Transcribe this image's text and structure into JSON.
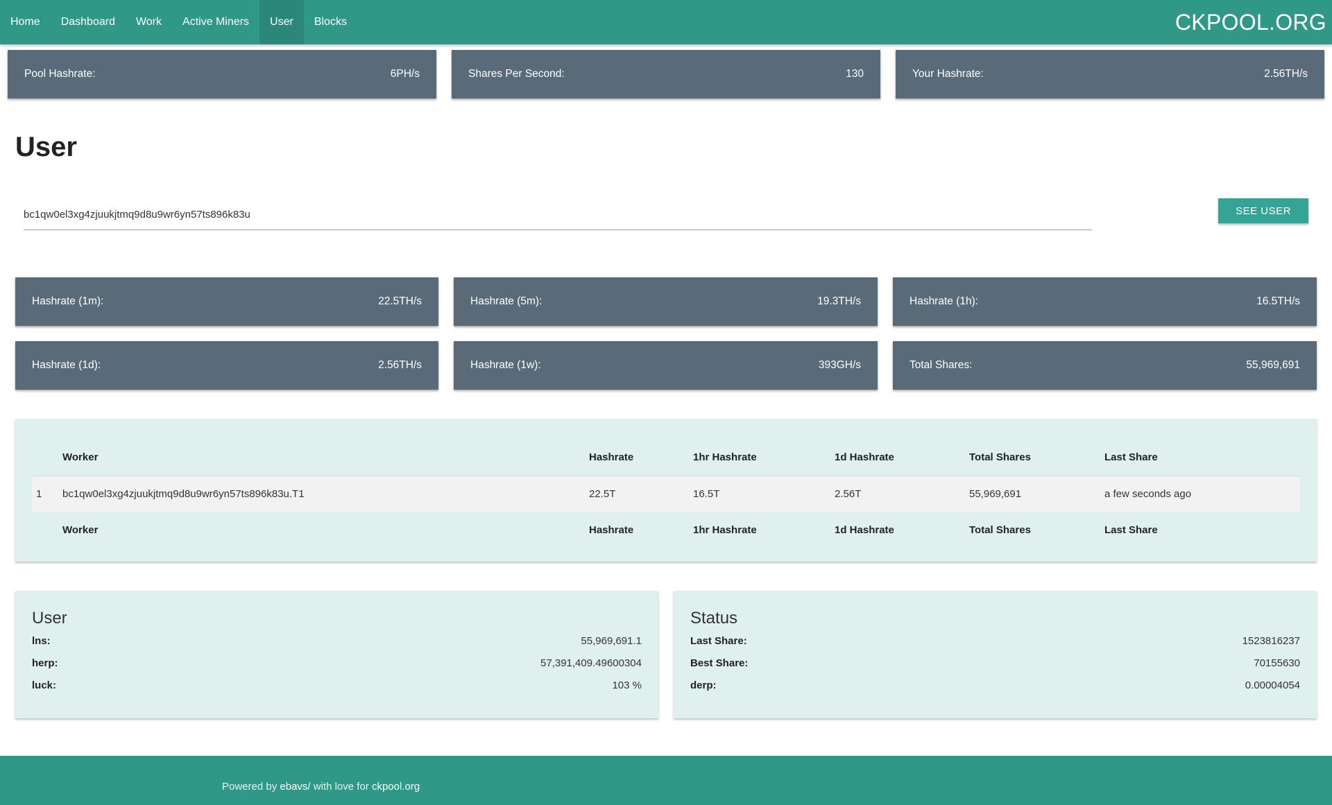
{
  "nav": {
    "items": [
      {
        "label": "Home",
        "active": false
      },
      {
        "label": "Dashboard",
        "active": false
      },
      {
        "label": "Work",
        "active": false
      },
      {
        "label": "Active Miners",
        "active": false
      },
      {
        "label": "User",
        "active": true
      },
      {
        "label": "Blocks",
        "active": false
      }
    ],
    "brand": "CKPOOL.ORG"
  },
  "pool_stats": [
    {
      "label": "Pool Hashrate:",
      "value": "6PH/s"
    },
    {
      "label": "Shares Per Second:",
      "value": "130"
    },
    {
      "label": "Your Hashrate:",
      "value": "2.56TH/s"
    }
  ],
  "page_title": "User",
  "search": {
    "value": "bc1qw0el3xg4zjuukjtmq9d8u9wr6yn57ts896k83u",
    "button_label": "SEE USER"
  },
  "user_stats": [
    {
      "label": "Hashrate (1m):",
      "value": "22.5TH/s"
    },
    {
      "label": "Hashrate (5m):",
      "value": "19.3TH/s"
    },
    {
      "label": "Hashrate (1h):",
      "value": "16.5TH/s"
    },
    {
      "label": "Hashrate (1d):",
      "value": "2.56TH/s"
    },
    {
      "label": "Hashrate (1w):",
      "value": "393GH/s"
    },
    {
      "label": "Total Shares:",
      "value": "55,969,691"
    }
  ],
  "workers_table": {
    "columns": [
      "Worker",
      "Hashrate",
      "1hr Hashrate",
      "1d Hashrate",
      "Total Shares",
      "Last Share"
    ],
    "rows": [
      {
        "num": "1",
        "worker": "bc1qw0el3xg4zjuukjtmq9d8u9wr6yn57ts896k83u.T1",
        "hashrate": "22.5T",
        "hashrate_1hr": "16.5T",
        "hashrate_1d": "2.56T",
        "total_shares": "55,969,691",
        "last_share": "a few seconds ago"
      }
    ]
  },
  "user_panel": {
    "title": "User",
    "rows": [
      {
        "key": "lns:",
        "value": "55,969,691.1"
      },
      {
        "key": "herp:",
        "value": "57,391,409.49600304"
      },
      {
        "key": "luck:",
        "value": "103 %"
      }
    ]
  },
  "status_panel": {
    "title": "Status",
    "rows": [
      {
        "key": "Last Share:",
        "value": "1523816237"
      },
      {
        "key": "Best Share:",
        "value": "70155630"
      },
      {
        "key": "derp:",
        "value": "0.00004054"
      }
    ]
  },
  "footer": {
    "prefix": "Powered by ",
    "author": "ebavs/",
    "middle": " with love for ",
    "site": "ckpool.org"
  },
  "colors": {
    "nav_bg": "#309887",
    "card_bg": "#596b78",
    "panel_bg": "#e0f0ee",
    "button_bg": "#35a396"
  }
}
